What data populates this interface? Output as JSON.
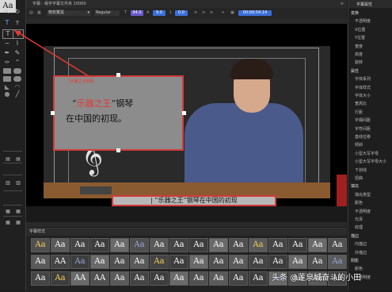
{
  "window": {
    "title": "字幕：缘宇字幕文件夹 10000",
    "format_font": "微软雅黑",
    "format_weight": "Regular",
    "format_size": "94.0",
    "format_value2": "9.0",
    "format_value3": "0.0",
    "format_time": "00:00:54:14"
  },
  "canvas": {
    "subtitle_big_line1_pre": "“",
    "subtitle_big_highlight": "乐器之王",
    "subtitle_big_line1_post": "”钢琴",
    "subtitle_big_line2": "在中国的初现。",
    "subtitle_bottom": "| “乐器之王”钢琴在中国的初现",
    "label_small": "|乐器之王钢琴"
  },
  "properties": {
    "title": "字幕属性",
    "items": [
      "变换",
      "不透明度",
      "X位置",
      "Y位置",
      "宽度",
      "高度",
      "旋转",
      "属性",
      "字体系列",
      "字体样式",
      "字体大小",
      "宽高比",
      "行距",
      "字偶间距",
      "字符间距",
      "基线位移",
      "倾斜",
      "小型大写字母",
      "小型大写字母大小",
      "下划线",
      "扭曲",
      "填充",
      "填充类型",
      "颜色",
      "不透明度",
      "光泽",
      "纹理",
      "描边",
      "内描边",
      "外描边",
      "阴影",
      "颜色",
      "不透明度"
    ]
  },
  "styles_panel": {
    "title": "字幕样式",
    "tiles": [
      "Aa",
      "Aa",
      "Aa",
      "Aa",
      "Aa",
      "Aa",
      "Aa",
      "Aa",
      "Aa",
      "Aa",
      "Aa",
      "Aa",
      "Aa",
      "Aa",
      "Aa",
      "Aa",
      "Aa",
      "AA",
      "Aa",
      "Aa",
      "Aa",
      "Aa",
      "Aa",
      "Aa",
      "Aa",
      "Aa",
      "Aa",
      "Aa",
      "Aa",
      "Aa",
      "Aa",
      "Aa",
      "Aa",
      "Aa",
      "AA",
      "AA",
      "Aa",
      "Aa",
      "Aa",
      "Aa",
      "Aa",
      "Aa",
      "Aa",
      "Aa",
      "Aa",
      "Aa",
      "Aa",
      "Aa"
    ]
  },
  "watermark": "头条 @莲泉城奋斗的小田",
  "colors": {
    "accent_red": "#e53935",
    "panel_bg": "#1e1e1e",
    "swatch_purple": "#6a5acd",
    "swatch_blue": "#3b6fd8"
  }
}
